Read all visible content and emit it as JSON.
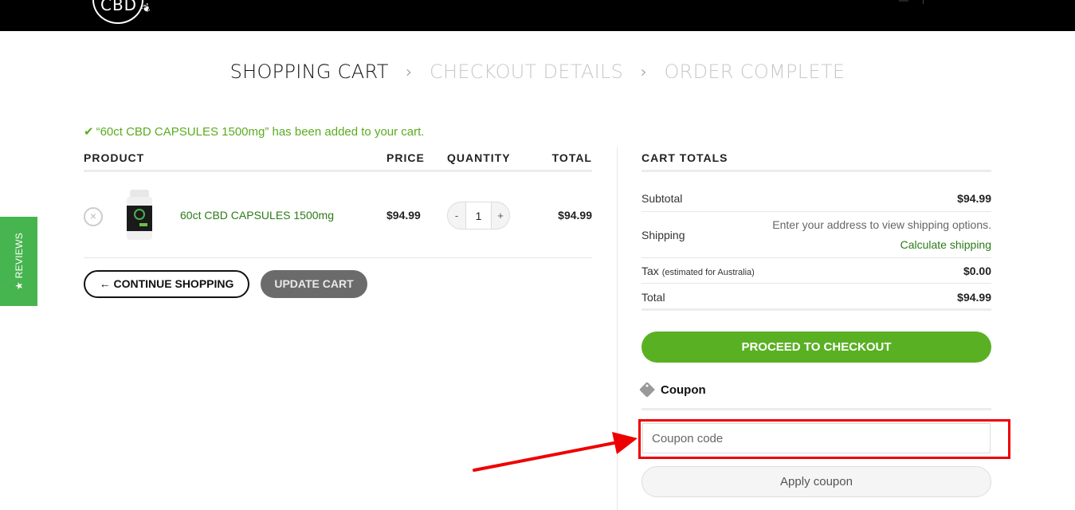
{
  "header": {
    "logo_text": "CBD"
  },
  "steps": [
    {
      "label": "SHOPPING CART",
      "active": true
    },
    {
      "label": "CHECKOUT DETAILS",
      "active": false
    },
    {
      "label": "ORDER COMPLETE",
      "active": false
    }
  ],
  "step_separator": "›",
  "notice": {
    "icon": "check-icon",
    "text": "“60ct CBD CAPSULES 1500mg” has been added to your cart."
  },
  "cart": {
    "columns": {
      "product": "PRODUCT",
      "price": "PRICE",
      "quantity": "QUANTITY",
      "total": "TOTAL"
    },
    "items": [
      {
        "name": "60ct CBD CAPSULES 1500mg",
        "price": "$94.99",
        "quantity": "1",
        "total": "$94.99",
        "remove_icon": "×",
        "qty_minus": "-",
        "qty_plus": "+"
      }
    ],
    "continue_label": "← CONTINUE SHOPPING",
    "update_label": "UPDATE CART"
  },
  "totals": {
    "title": "CART TOTALS",
    "subtotal_label": "Subtotal",
    "subtotal_value": "$94.99",
    "shipping_label": "Shipping",
    "shipping_note": "Enter your address to view shipping options.",
    "calculate_shipping": "Calculate shipping",
    "tax_label": "Tax",
    "tax_note": "(estimated for Australia)",
    "tax_value": "$0.00",
    "total_label": "Total",
    "total_value": "$94.99",
    "checkout_label": "PROCEED TO CHECKOUT"
  },
  "coupon": {
    "heading": "Coupon",
    "input_value": "",
    "placeholder": "Coupon code",
    "apply_label": "Apply coupon"
  },
  "reviews_tab": {
    "label": "★ REVIEWS"
  },
  "annotation": {
    "highlight_color": "#ee0000"
  },
  "colors": {
    "accent_green": "#5ab023",
    "link_green": "#2d7a1a",
    "reviews_green": "#47b54f"
  }
}
